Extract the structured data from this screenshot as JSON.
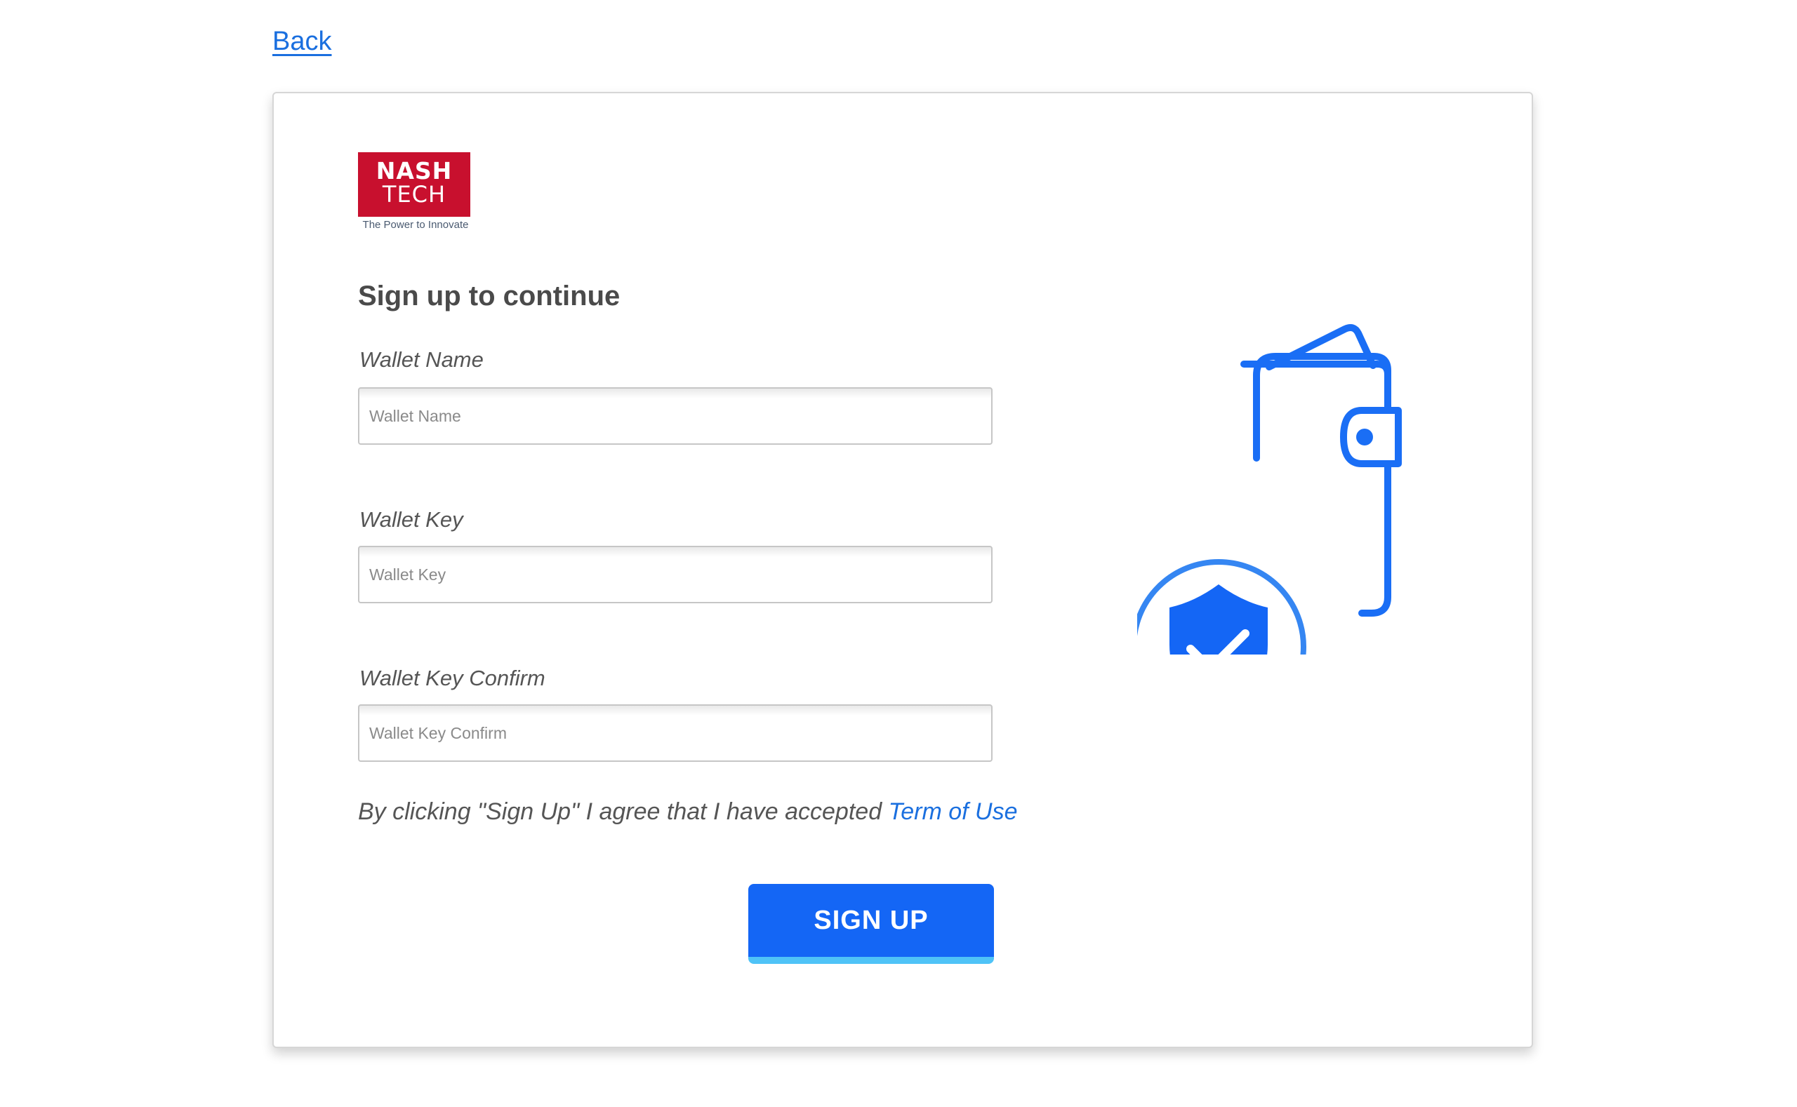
{
  "nav": {
    "back_label": "Back"
  },
  "logo": {
    "line1": "NASH",
    "line2": "TECH",
    "tagline": "The Power to Innovate"
  },
  "form": {
    "title": "Sign up to continue",
    "fields": [
      {
        "label": "Wallet Name",
        "placeholder": "Wallet Name",
        "value": ""
      },
      {
        "label": "Wallet Key",
        "placeholder": "Wallet Key",
        "value": ""
      },
      {
        "label": "Wallet Key Confirm",
        "placeholder": "Wallet Key Confirm",
        "value": ""
      }
    ],
    "terms_text": "By clicking \"Sign Up\" I agree that I have accepted ",
    "terms_link": "Term of Use",
    "submit_label": "SIGN UP"
  },
  "illustration": {
    "icons": [
      "wallet-icon",
      "shield-check-icon"
    ]
  },
  "colors": {
    "accent": "#1466f5",
    "link": "#1a6fdf",
    "button_bottom": "#4fc3f7",
    "logo_red": "#c8102e",
    "text": "#555555"
  }
}
